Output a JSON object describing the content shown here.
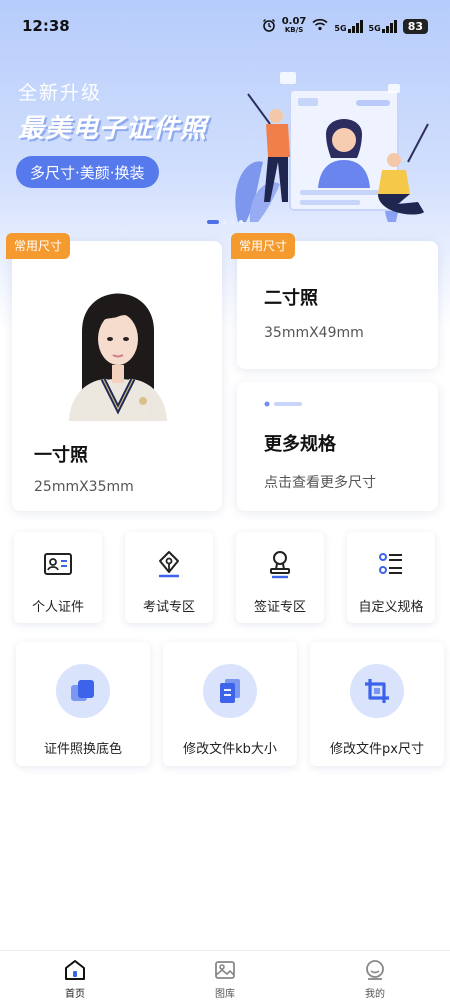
{
  "status_bar": {
    "time": "12:38",
    "net_speed": "0.07",
    "net_unit": "KB/S",
    "sig1": "5G",
    "sig2": "5G",
    "battery": "83"
  },
  "banner": {
    "subtitle": "全新升级",
    "title": "最美电子证件照",
    "pill": "多尺寸·美颜·换装"
  },
  "cards": {
    "one_inch": {
      "badge": "常用尺寸",
      "title": "一寸照",
      "size": "25mmX35mm"
    },
    "two_inch": {
      "badge": "常用尺寸",
      "title": "二寸照",
      "size": "35mmX49mm"
    },
    "more": {
      "title": "更多规格",
      "desc": "点击查看更多尺寸"
    }
  },
  "tiles": [
    {
      "label": "个人证件",
      "icon": "id-card-icon"
    },
    {
      "label": "考试专区",
      "icon": "pen-nib-icon"
    },
    {
      "label": "签证专区",
      "icon": "stamp-icon"
    },
    {
      "label": "自定义规格",
      "icon": "list-icon"
    }
  ],
  "tools": [
    {
      "label": "证件照换底色",
      "icon": "layers-icon"
    },
    {
      "label": "修改文件kb大小",
      "icon": "file-icon"
    },
    {
      "label": "修改文件px尺寸",
      "icon": "crop-icon"
    }
  ],
  "nav": [
    {
      "label": "首页",
      "icon": "home-icon",
      "active": true
    },
    {
      "label": "图库",
      "icon": "gallery-icon",
      "active": false
    },
    {
      "label": "我的",
      "icon": "profile-icon",
      "active": false
    }
  ],
  "colors": {
    "accent": "#4f70e6",
    "badge": "#f49a2e",
    "tool_circle": "#d9e3fc"
  }
}
